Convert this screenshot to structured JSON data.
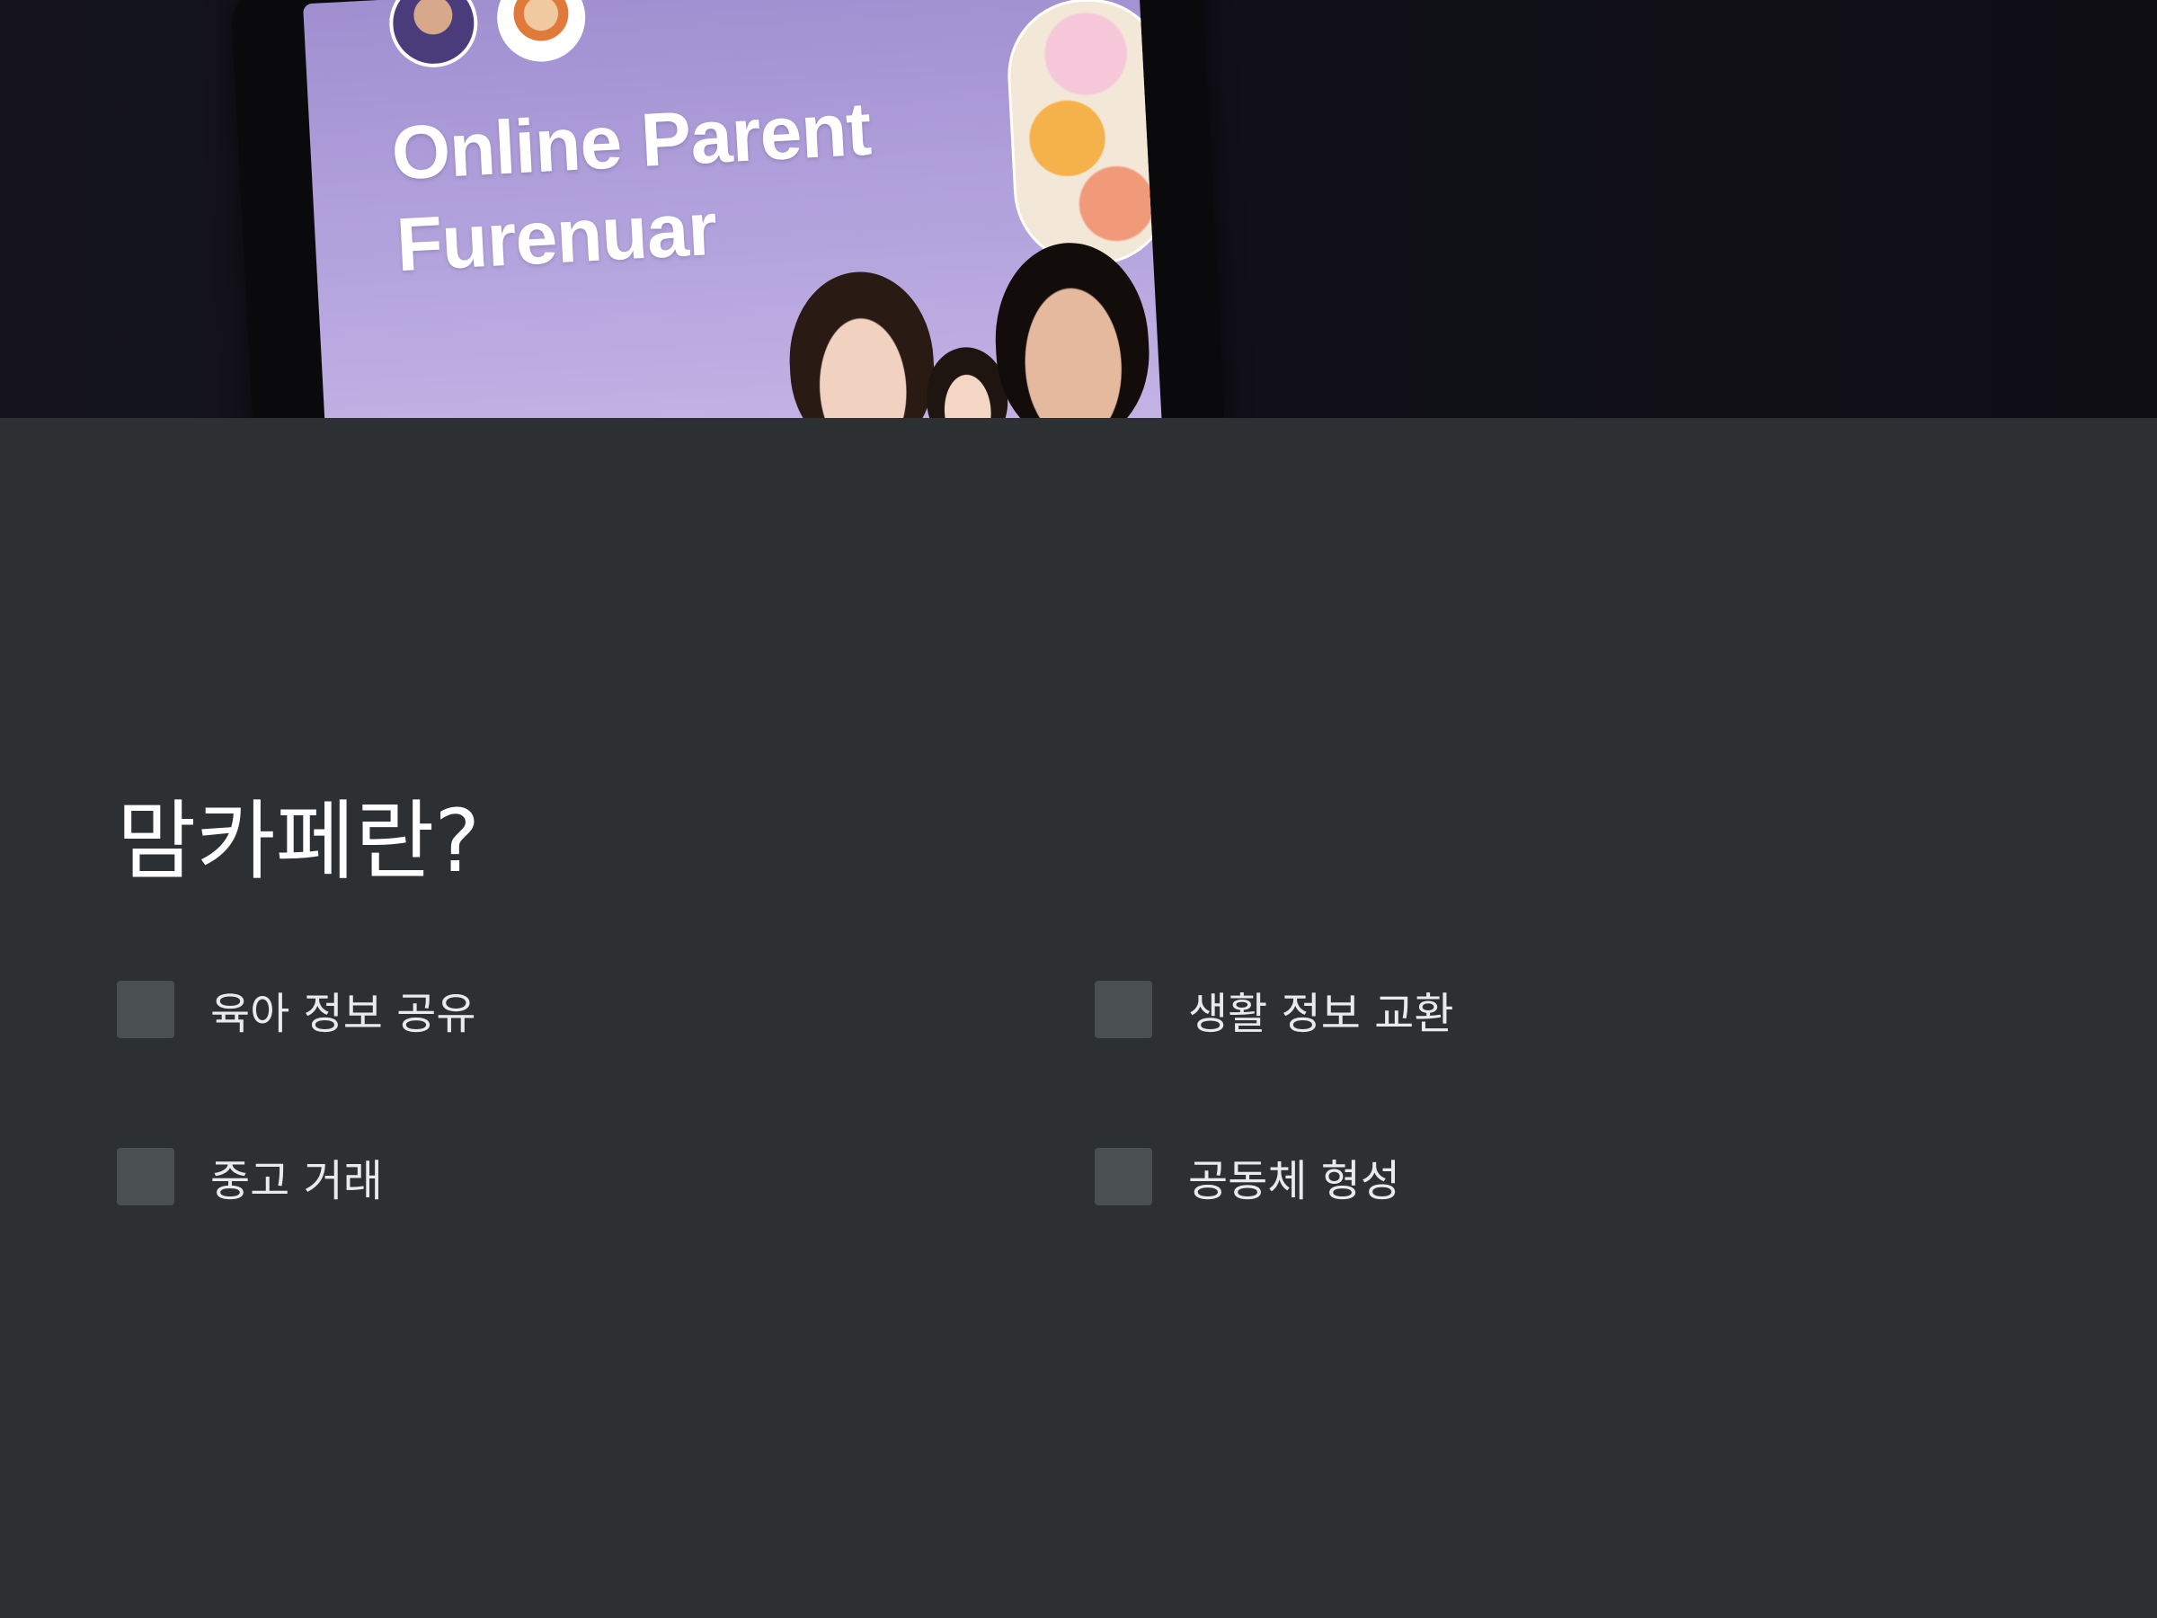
{
  "hero": {
    "image_title_line1": "Online Parent",
    "image_title_line2": "Furenuar"
  },
  "section": {
    "heading": "맘카페란?",
    "items": [
      {
        "label": "육아 정보 공유"
      },
      {
        "label": "생활 정보 교환"
      },
      {
        "label": "중고 거래"
      },
      {
        "label": "공동체 형성"
      }
    ]
  },
  "colors": {
    "background": "#2c3032",
    "checkbox": "#4a4f52",
    "hero_background": "#121119",
    "screen_purple": "#a08fd0"
  }
}
